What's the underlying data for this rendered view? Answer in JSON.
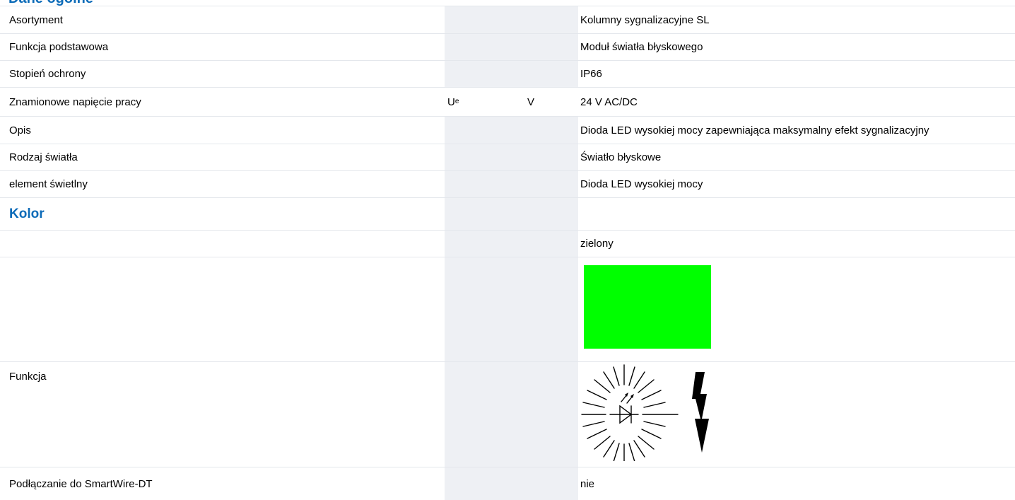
{
  "section_top": {
    "title": "Dane ogólne"
  },
  "rows": [
    {
      "label": "Asortyment",
      "symbol": "",
      "unit": "",
      "value": "Kolumny sygnalizacyjne SL"
    },
    {
      "label": "Funkcja podstawowa",
      "symbol": "",
      "unit": "",
      "value": "Moduł światła błyskowego"
    },
    {
      "label": "Stopień ochrony",
      "symbol": "",
      "unit": "",
      "value": "IP66"
    },
    {
      "label": "Znamionowe napięcie pracy",
      "symbol": "U",
      "symbol_sub": "e",
      "unit": "V",
      "value": "24 V AC/DC"
    },
    {
      "label": "Opis",
      "symbol": "",
      "unit": "",
      "value": "Dioda LED wysokiej mocy zapewniająca maksymalny efekt sygnalizacyjny"
    },
    {
      "label": "Rodzaj światła",
      "symbol": "",
      "unit": "",
      "value": "Światło błyskowe"
    },
    {
      "label": "element świetlny",
      "symbol": "",
      "unit": "",
      "value": "Dioda LED wysokiej mocy"
    }
  ],
  "color_section": {
    "title": "Kolor",
    "value": "zielony",
    "swatch_color": "#00ff00"
  },
  "function_row": {
    "label": "Funkcja",
    "icon": "flashing-led-icon"
  },
  "smartwire_row": {
    "label": "Podłączanie do SmartWire-DT",
    "value": "nie"
  },
  "colors": {
    "accent": "#0c6bb8",
    "shaded_column": "#eef0f4",
    "divider": "#e4e7ec"
  }
}
